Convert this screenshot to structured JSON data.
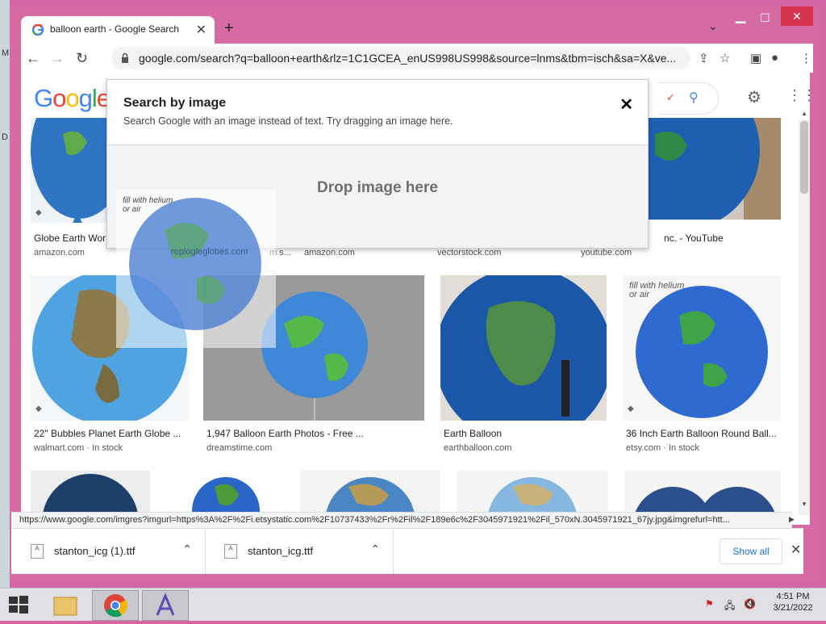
{
  "browser": {
    "tab_title": "balloon earth - Google Search",
    "address": "google.com/search?q=balloon+earth&rlz=1C1GCEA_enUS998US998&source=lnms&tbm=isch&sa=X&ve...",
    "status_url": "https://www.google.com/imgres?imgurl=https%3A%2F%2Fi.etsystatic.com%2F10737433%2Fr%2Fil%2F189e6c%2F3045971921%2Fil_570xN.3045971921_67jy.jpg&imgrefurl=htt..."
  },
  "google": {
    "logo_letters": [
      "G",
      "o",
      "o",
      "g",
      "l",
      "e"
    ],
    "logo_colors": [
      "#4285F4",
      "#EA4335",
      "#FBBC05",
      "#4285F4",
      "#34A853",
      "#EA4335"
    ]
  },
  "dialog": {
    "title": "Search by image",
    "subtitle": "Search Google with an image instead of text. Try dragging an image here.",
    "drop_text": "Drop image here"
  },
  "drag_ghost": {
    "watermark": "fill with helium or air",
    "source_label": "replogleglobes.com"
  },
  "results": {
    "row1": [
      {
        "title": "Globe Earth Wor",
        "source": "amazon.com"
      },
      {
        "title": "",
        "source": "amazon.com"
      },
      {
        "title": "",
        "source": "vectorstock.com"
      },
      {
        "title": "nc. - YouTube",
        "source": "youtube.com"
      }
    ],
    "row1_partial_source": "m s...",
    "row1_image_watermark": "fill with helium or air",
    "row2": [
      {
        "title": "22\" Bubbles Planet Earth Globe ...",
        "source": "walmart.com",
        "stock": "In stock"
      },
      {
        "title": "1,947 Balloon Earth Photos - Free ...",
        "source": "dreamstime.com"
      },
      {
        "title": "Earth Balloon",
        "source": "earthballoon.com"
      },
      {
        "title": "36 Inch Earth Balloon Round Ball...",
        "source": "etsy.com",
        "stock": "In stock"
      }
    ],
    "row2_image_watermark": "fill with helium or air"
  },
  "downloads": {
    "items": [
      {
        "name": "stanton_icg (1).ttf"
      },
      {
        "name": "stanton_icg.ttf"
      }
    ],
    "show_all": "Show all"
  },
  "taskbar": {
    "time": "4:51 PM",
    "date": "3/21/2022"
  }
}
